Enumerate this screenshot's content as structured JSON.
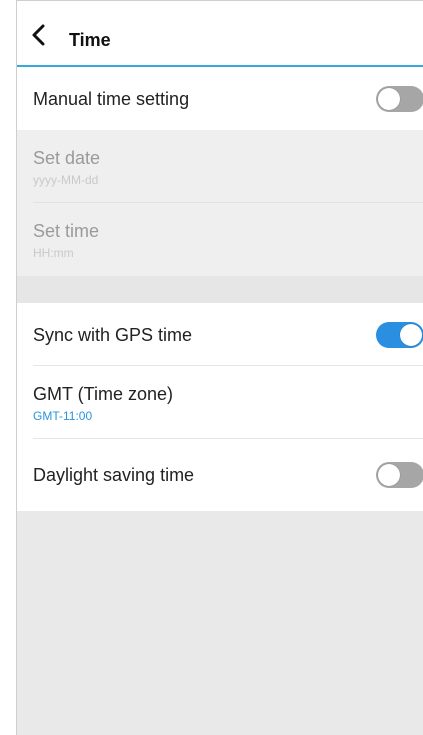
{
  "header": {
    "title": "Time"
  },
  "manual_time": {
    "label": "Manual time setting",
    "enabled": false
  },
  "set_date": {
    "label": "Set date",
    "placeholder": "yyyy-MM-dd"
  },
  "set_time": {
    "label": "Set time",
    "placeholder": "HH:mm"
  },
  "gps_sync": {
    "label": "Sync with GPS time",
    "enabled": true
  },
  "timezone": {
    "label": "GMT (Time zone)",
    "value": "GMT-11:00"
  },
  "daylight": {
    "label": "Daylight saving time",
    "enabled": false
  },
  "colors": {
    "accent": "#2a8fe0",
    "divider_blue": "#35a8e0",
    "background": "#e9e9e9"
  },
  "icons": {
    "back": "chevron-left-icon"
  }
}
